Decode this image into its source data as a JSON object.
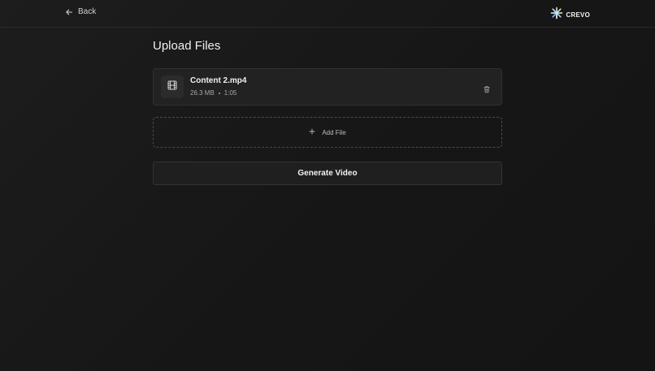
{
  "header": {
    "back_label": "Back",
    "brand_name": "CREVO"
  },
  "main": {
    "title": "Upload Files",
    "files": [
      {
        "name": "Content 2.mp4",
        "size": "26.3 MB",
        "duration": "1:05"
      }
    ],
    "add_file_label": "Add File",
    "generate_label": "Generate Video"
  },
  "icons": {
    "back": "arrow-left-icon",
    "brand": "crevo-logo-icon",
    "file": "film-icon",
    "delete": "trash-icon",
    "add": "plus-icon"
  },
  "colors": {
    "background": "#181818",
    "card": "#222222",
    "text": "#f2f2f2",
    "muted": "#a8a8a8"
  }
}
